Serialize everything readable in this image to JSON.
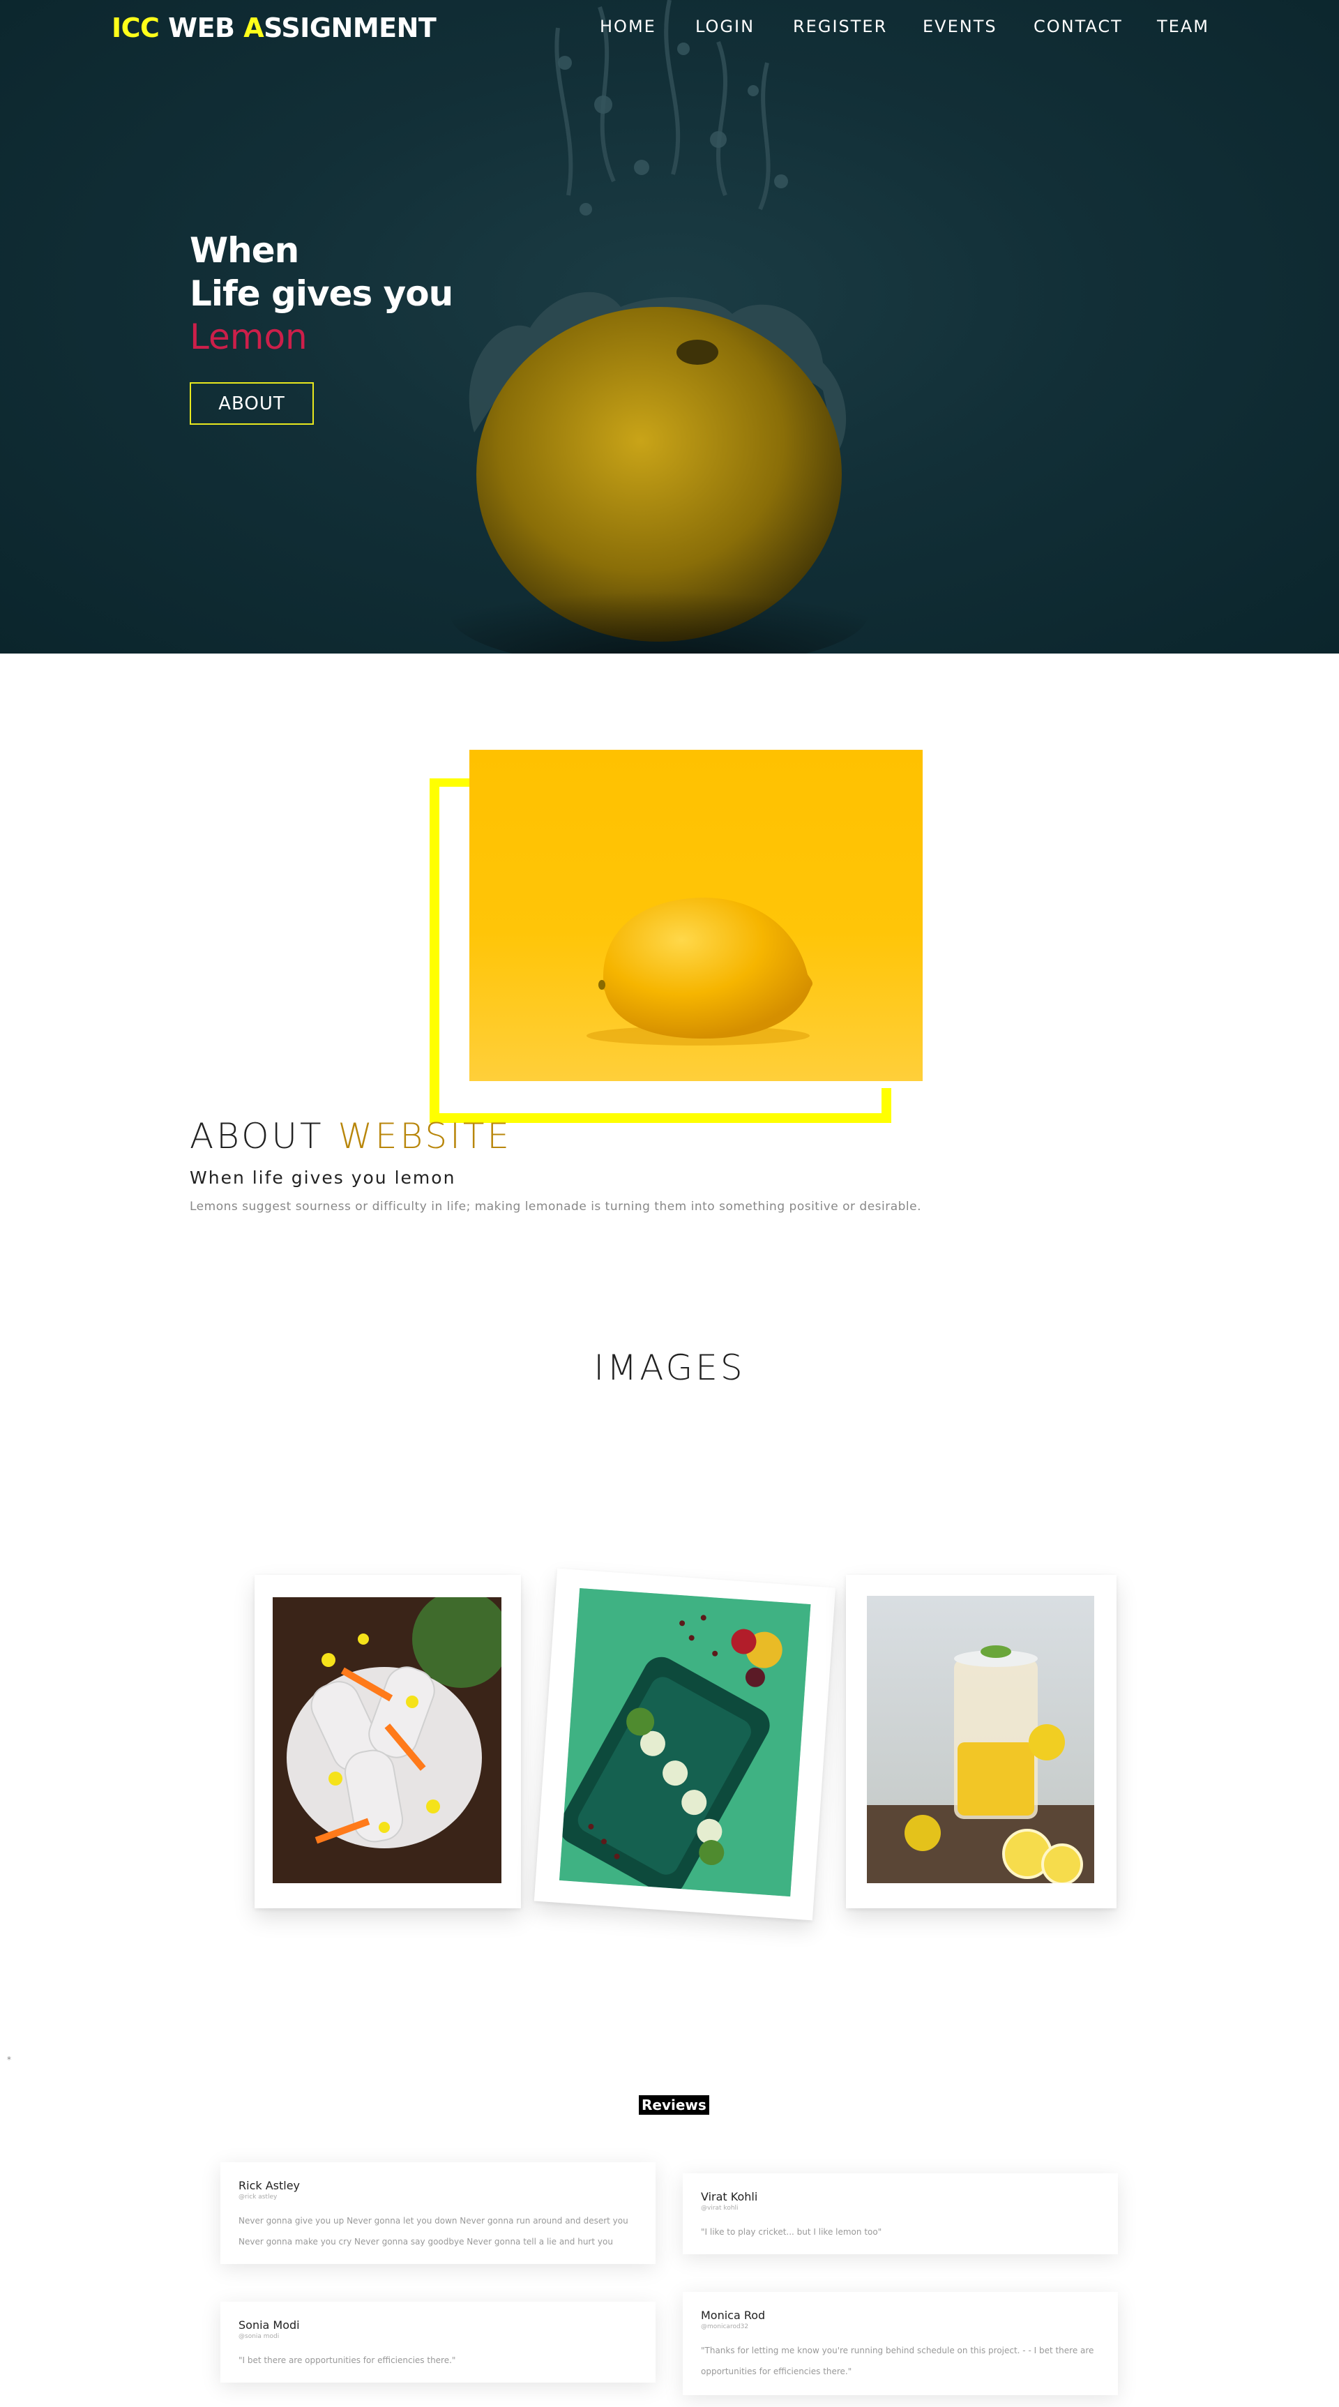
{
  "header": {
    "brand": {
      "part1": "ICC",
      "part2": "WEB",
      "part3": "A",
      "part4": "SSIGNMENT"
    },
    "nav": [
      "HOME",
      "LOGIN",
      "REGISTER",
      "EVENTS",
      "CONTACT",
      "TEAM"
    ]
  },
  "hero": {
    "line1": "When",
    "line2": "Life gives you",
    "line3": "Lemon",
    "button": "ABOUT"
  },
  "about": {
    "title_main": "ABOUT ",
    "title_accent": "WEBSITE",
    "subtitle": "When life gives you lemon",
    "description": "Lemons suggest sourness or difficulty in life; making lemonade is turning them into something positive or desirable."
  },
  "images": {
    "title": "IMAGES"
  },
  "reviews": {
    "title": "Reviews",
    "marker": "*",
    "items": [
      {
        "name": "Rick Astley",
        "handle": "@rick astley",
        "text": "Never gonna give you up Never gonna let you down Never gonna run around and desert you Never gonna make you cry Never gonna say goodbye Never gonna tell a lie and hurt you"
      },
      {
        "name": "Virat Kohli",
        "handle": "@virat kohli",
        "text": "\"I like to play cricket... but I like lemon too\""
      },
      {
        "name": "Sonia Modi",
        "handle": "@sonia modi",
        "text": "\"I bet there are opportunities for efficiencies there.\""
      },
      {
        "name": "Monica Rod",
        "handle": "@monicarod32",
        "text": "\"Thanks for letting me know you're running behind schedule on this project. - - I bet there are opportunities for efficiencies there.\""
      }
    ]
  },
  "colors": {
    "accent_yellow": "#ffff00",
    "lemon_red": "#cc1f4a",
    "website_gold": "#b8860b",
    "hero_bg": "#122f37"
  }
}
